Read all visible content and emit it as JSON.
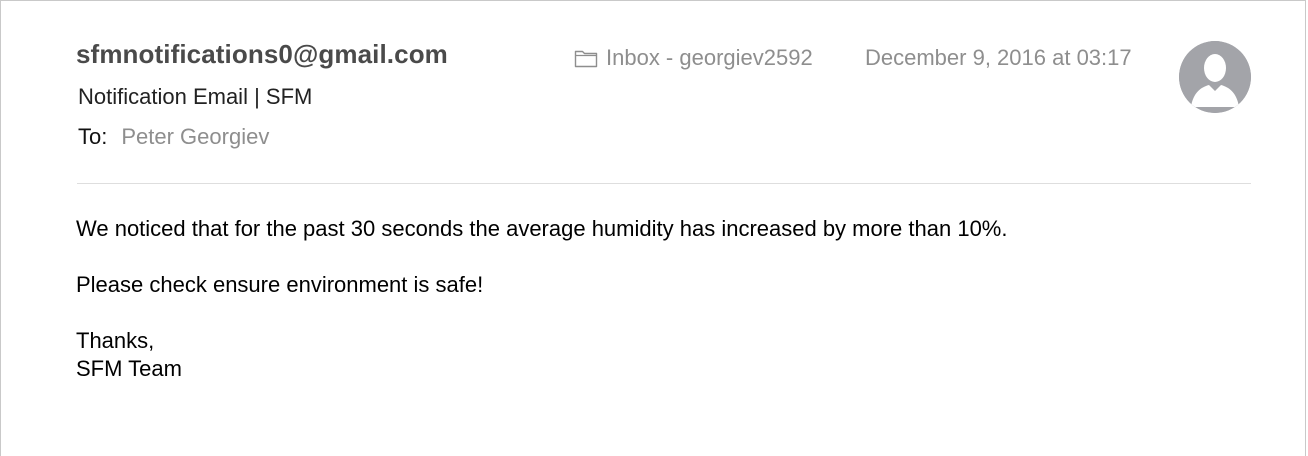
{
  "email": {
    "sender": "sfmnotifications0@gmail.com",
    "subject": "Notification Email | SFM",
    "to_label": "To:",
    "to_name": "Peter Georgiev",
    "mailbox": "Inbox - georgiev2592",
    "date": "December 9, 2016 at 03:17"
  },
  "body": {
    "line1": "We noticed that for the past 30 seconds the average humidity  has increased by more than 10%.",
    "line2": "Please check ensure environment is safe!",
    "line3": "Thanks,",
    "line4": "SFM Team"
  },
  "icons": {
    "mailbox_icon": "folder-icon",
    "avatar_icon": "person-silhouette-icon"
  },
  "colors": {
    "sender": "#4a4a4a",
    "muted": "#8e8e8e",
    "avatar_bg": "#a3a4a9",
    "divider": "#dedede"
  }
}
